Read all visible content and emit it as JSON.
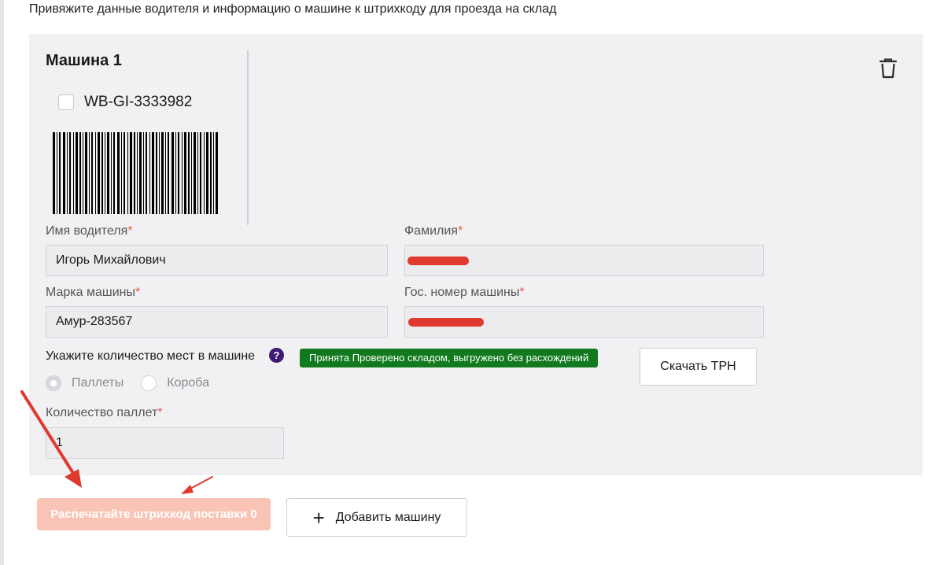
{
  "intro_text": "Привяжите данные водителя и информацию о машине к штрихкоду для проезда на склад",
  "car": {
    "title": "Машина 1",
    "barcode_id": "WB-GI-3333982",
    "driver_name_label": "Имя водителя",
    "driver_name_value": "Игорь Михайлович",
    "surname_label": "Фамилия",
    "brand_label": "Марка машины",
    "brand_value": "Амур-283567",
    "plate_label": "Гос. номер машины",
    "places_question": "Укажите количество мест в машине",
    "status_badge": "Принята Проверено складом, выгружено без расхождений",
    "download_button": "Скачать ТРН",
    "radio_pallets": "Паллеты",
    "radio_boxes": "Короба",
    "selected_radio": "Паллеты",
    "pallet_count_label": "Количество паллет",
    "pallet_count_value": "1"
  },
  "required_mark": "*",
  "help_icon": "?",
  "print_button": "Распечатайте штрихкод поставки 0",
  "add_car_button": "Добавить машину",
  "icons": {
    "delete": "trash-icon",
    "add": "plus-icon",
    "help": "question-icon"
  },
  "colors": {
    "card_bg": "#f1f1f3",
    "status_badge_bg": "#127a1e",
    "print_button_bg": "#f9c4b6",
    "required": "#e35b4b",
    "help_icon_bg": "#3d1a78",
    "annotation_arrow": "#e03a2f"
  }
}
